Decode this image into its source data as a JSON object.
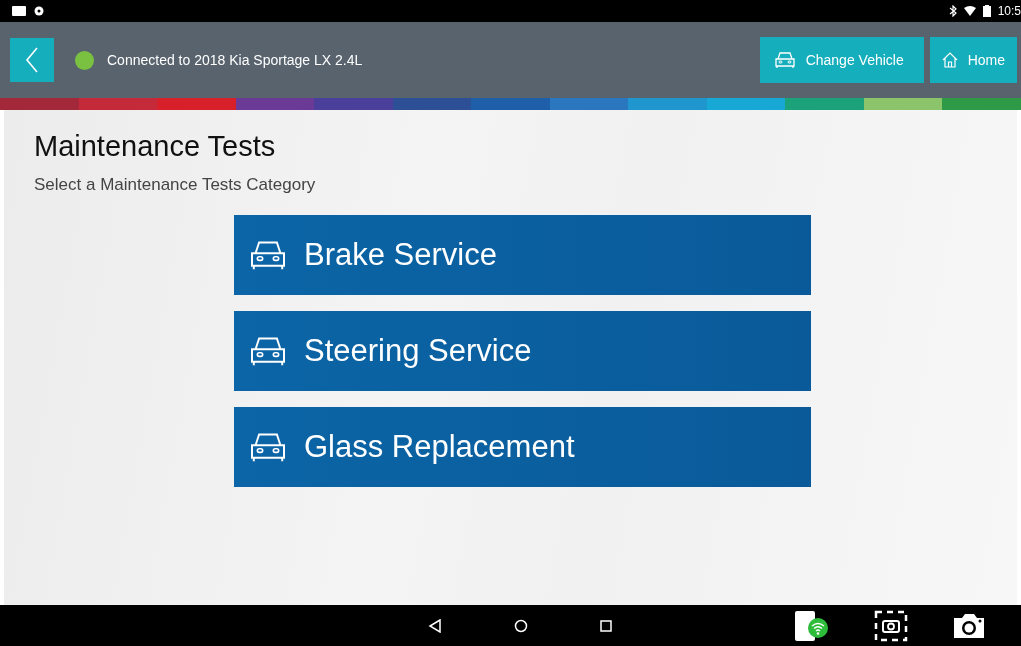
{
  "status_bar": {
    "time": "10:5"
  },
  "header": {
    "connection": {
      "connected": true,
      "label": "Connected to 2018 Kia Sportage LX 2.4L"
    },
    "buttons": [
      {
        "kind": "vehicle",
        "label": "Change Vehicle"
      },
      {
        "kind": "home",
        "label": "Home"
      }
    ]
  },
  "page": {
    "title": "Maintenance Tests",
    "subtitle": "Select a Maintenance Tests Category"
  },
  "categories": [
    {
      "label": "Brake Service"
    },
    {
      "label": "Steering Service"
    },
    {
      "label": "Glass Replacement"
    }
  ]
}
